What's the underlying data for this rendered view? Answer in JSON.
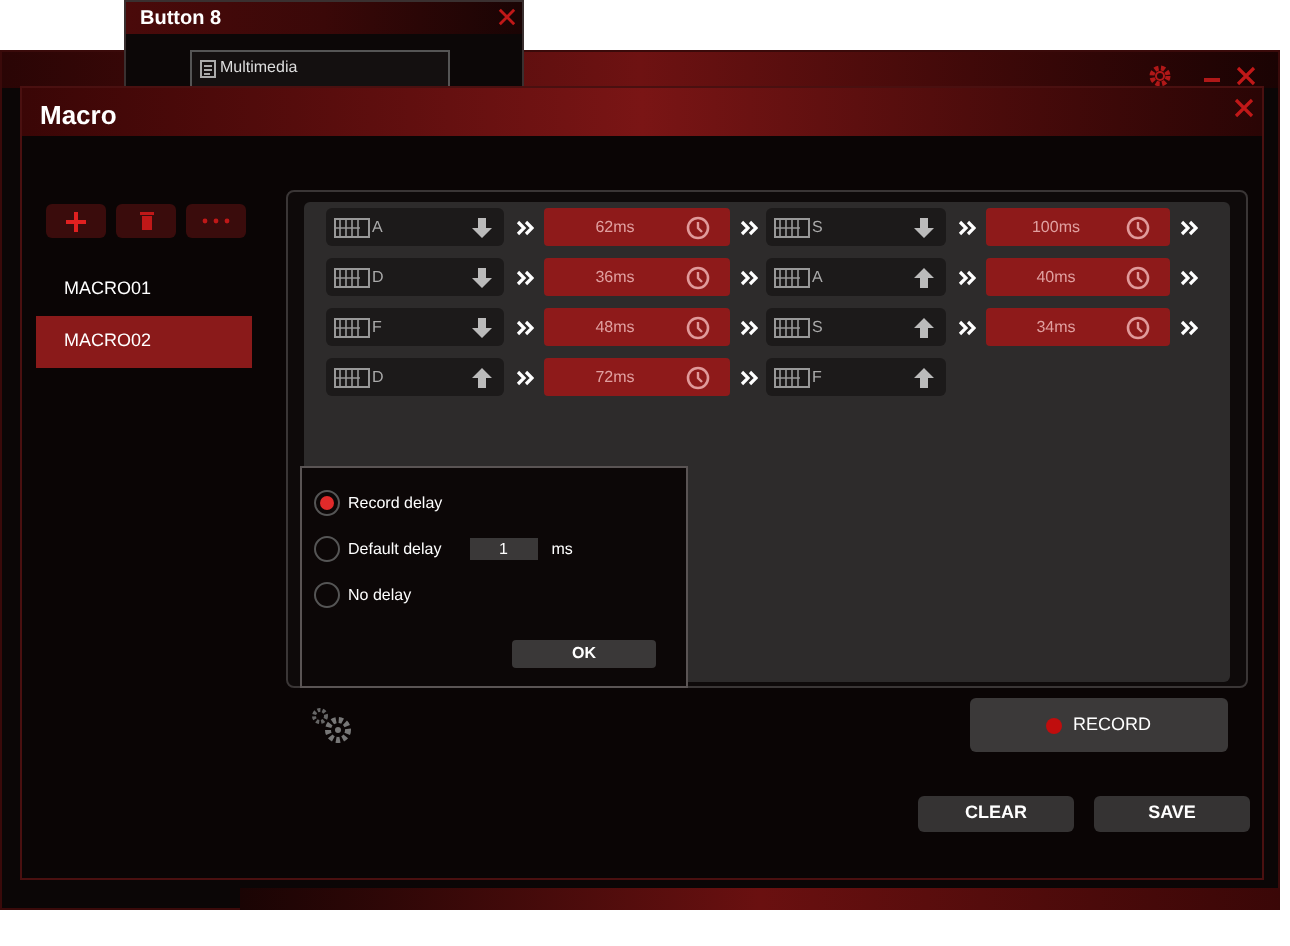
{
  "background_window": {
    "title": "Button 8",
    "field": "Multimedia"
  },
  "dialog": {
    "title": "Macro"
  },
  "macros": [
    {
      "label": "MACRO01",
      "selected": false
    },
    {
      "label": "MACRO02",
      "selected": true
    }
  ],
  "events": [
    {
      "items": [
        {
          "kind": "key",
          "key": "A",
          "released": false
        },
        {
          "kind": "delay",
          "time": "62ms"
        },
        {
          "kind": "key",
          "key": "S",
          "released": false
        },
        {
          "kind": "delay",
          "time": "100ms"
        }
      ]
    },
    {
      "items": [
        {
          "kind": "key",
          "key": "D",
          "released": false
        },
        {
          "kind": "delay",
          "time": "36ms"
        },
        {
          "kind": "key",
          "key": "A",
          "released": true
        },
        {
          "kind": "delay",
          "time": "40ms"
        }
      ]
    },
    {
      "items": [
        {
          "kind": "key",
          "key": "F",
          "released": false
        },
        {
          "kind": "delay",
          "time": "48ms"
        },
        {
          "kind": "key",
          "key": "S",
          "released": true
        },
        {
          "kind": "delay",
          "time": "34ms"
        }
      ]
    },
    {
      "items": [
        {
          "kind": "key",
          "key": "D",
          "released": true
        },
        {
          "kind": "delay",
          "time": "72ms"
        },
        {
          "kind": "key",
          "key": "F",
          "released": true
        }
      ]
    }
  ],
  "delay_options": [
    {
      "label": "Record delay",
      "selected": true
    },
    {
      "label": "Default delay",
      "selected": false
    },
    {
      "label": "No delay",
      "selected": false
    }
  ],
  "default_delay": {
    "value": "1",
    "unit": "ms"
  },
  "ok_button": "OK",
  "record_button": "RECORD",
  "buttons": [
    "CLEAR",
    "SAVE"
  ]
}
